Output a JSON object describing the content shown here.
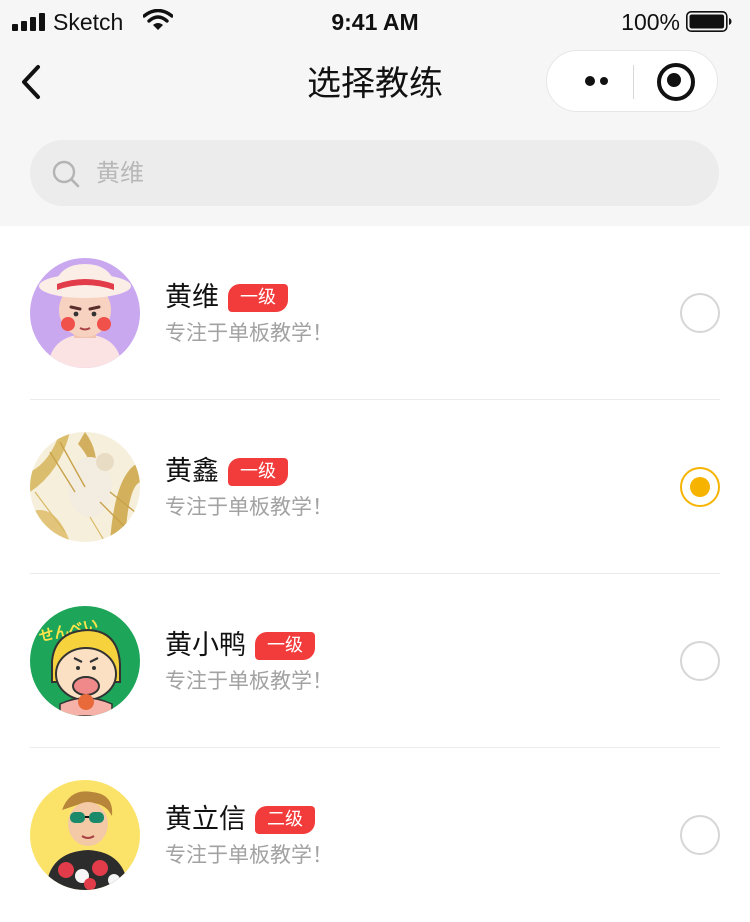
{
  "status_bar": {
    "carrier": "Sketch",
    "time": "9:41 AM",
    "battery": "100%"
  },
  "nav": {
    "title": "选择教练"
  },
  "search": {
    "placeholder": "黄维",
    "value": ""
  },
  "coaches": [
    {
      "name": "黄维",
      "level": "一级",
      "desc": "专注于单板教学！",
      "selected": false
    },
    {
      "name": "黄鑫",
      "level": "一级",
      "desc": "专注于单板教学！",
      "selected": true
    },
    {
      "name": "黄小鸭",
      "level": "一级",
      "desc": "专注于单板教学！",
      "selected": false
    },
    {
      "name": "黄立信",
      "level": "二级",
      "desc": "专注于单板教学！",
      "selected": false
    }
  ],
  "avatar_texts": {
    "duck_sign": "せんべい"
  },
  "colors": {
    "accent": "#f6b400",
    "badge": "#f23c3c",
    "search_bg": "#ececec"
  },
  "icons": [
    "signal-icon",
    "wifi-icon",
    "battery-icon",
    "back-icon",
    "more-icon",
    "close-icon",
    "search-icon",
    "radio-icon"
  ]
}
